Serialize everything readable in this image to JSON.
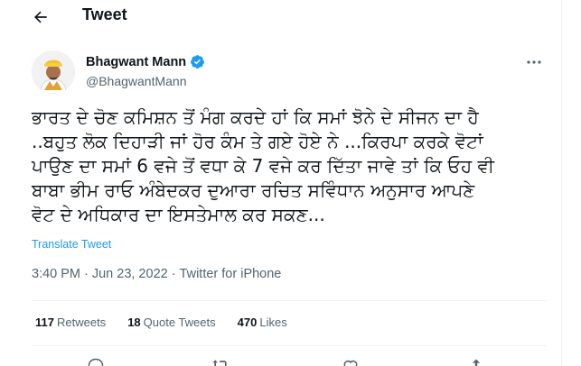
{
  "header": {
    "title": "Tweet"
  },
  "author": {
    "name": "Bhagwant Mann",
    "handle": "@BhagwantMann",
    "verified_color": "#1d9bf0"
  },
  "tweet": {
    "lines": [
      "ਭਾਰਤ ਦੇ ਚੋਣ ਕਮਿਸ਼ਨ ਤੋਂ ਮੰਗ ਕਰਦੇ ਹਾਂ ਕਿ ਸਮਾਂ ਝੋਨੇ ਦੇ ਸੀਜਨ ਦਾ ਹੈ",
      "..ਬਹੁਤ ਲੋਕ ਦਿਹਾੜੀ ਜਾਂ ਹੋਰ ਕੰਮ ਤੇ ਗਏ ਹੋਏ ਨੇ ...ਕਿਰਪਾ ਕਰਕੇ ਵੋਟਾਂ",
      "ਪਾਉਣ ਦਾ ਸਮਾਂ 6 ਵਜੇ ਤੋਂ ਵਧਾ ਕੇ 7 ਵਜੇ ਕਰ ਦਿੱਤਾ ਜਾਵੇ ਤਾਂ ਕਿ ਓਹ ਵੀ",
      "ਬਾਬਾ ਭੀਮ ਰਾਓ ਅੰਬੇਦਕਰ ਦੁਆਰਾ ਰਚਿਤ ਸਵਿੰਧਾਨ ਅਨੁਸਾਰ ਆਪਣੇ",
      "ਵੋਟ ਦੇ ਅਧਿਕਾਰ ਦਾ ਇਸਤੇਮਾਲ ਕਰ ਸਕਣ..."
    ],
    "translate_label": "Translate Tweet"
  },
  "meta": {
    "time": "3:40 PM",
    "separator": "·",
    "date": "Jun 23, 2022",
    "source": "Twitter for iPhone"
  },
  "stats": {
    "retweets_count": "117",
    "retweets_label": "Retweets",
    "quotes_count": "18",
    "quotes_label": "Quote Tweets",
    "likes_count": "470",
    "likes_label": "Likes"
  },
  "icons": {
    "back": "arrow-left-icon",
    "verified": "verified-badge-icon",
    "more": "more-horizontal-icon",
    "reply": "reply-icon",
    "retweet": "retweet-icon",
    "like": "heart-icon",
    "share": "share-icon"
  },
  "colors": {
    "link": "#1d9bf0",
    "muted": "#536471",
    "text": "#0f1419"
  }
}
